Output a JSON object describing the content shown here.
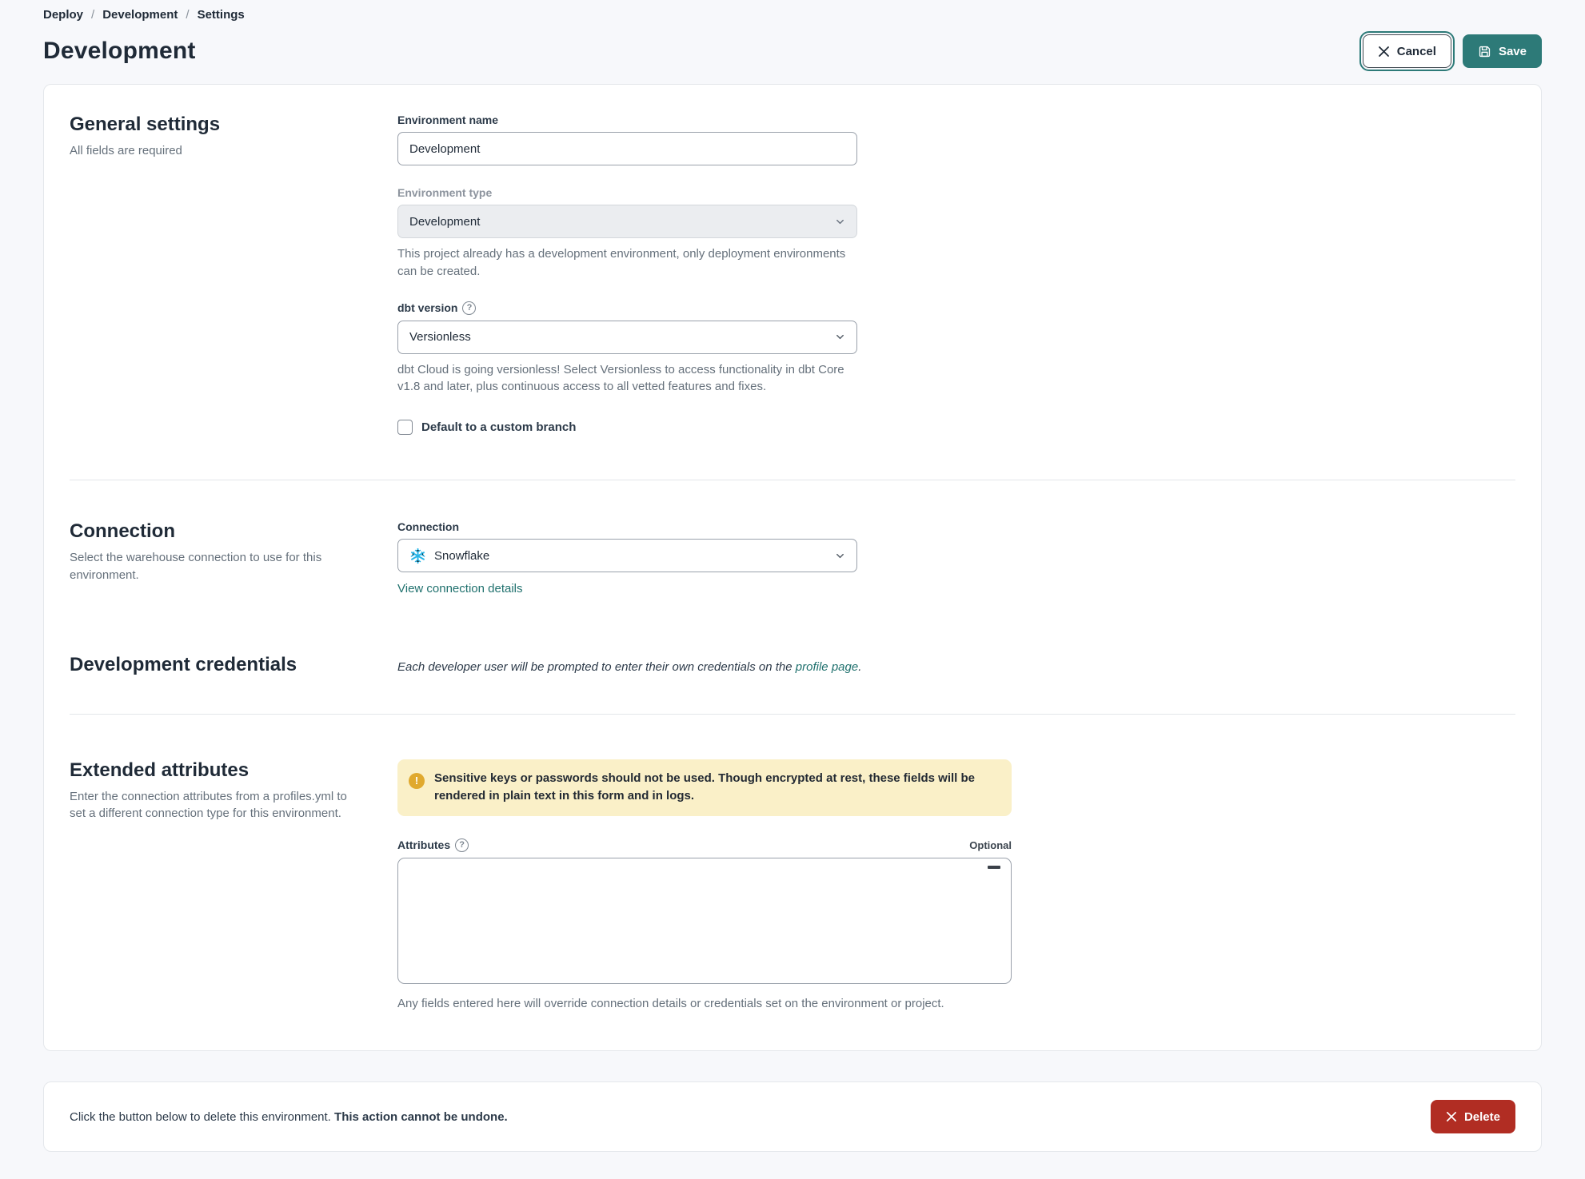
{
  "breadcrumb": {
    "items": [
      "Deploy",
      "Development",
      "Settings"
    ],
    "separator": "/"
  },
  "header": {
    "title": "Development",
    "cancel_label": "Cancel",
    "save_label": "Save"
  },
  "general": {
    "heading": "General settings",
    "subheading": "All fields are required",
    "env_name": {
      "label": "Environment name",
      "value": "Development"
    },
    "env_type": {
      "label": "Environment type",
      "value": "Development",
      "help": "This project already has a development environment, only deployment environments can be created."
    },
    "dbt_version": {
      "label": "dbt version",
      "value": "Versionless",
      "help": "dbt Cloud is going versionless! Select Versionless to access functionality in dbt Core v1.8 and later, plus continuous access to all vetted features and fixes."
    },
    "custom_branch": {
      "label": "Default to a custom branch",
      "checked": false
    }
  },
  "connection": {
    "heading": "Connection",
    "subheading": "Select the warehouse connection to use for this environment.",
    "field_label": "Connection",
    "value": "Snowflake",
    "link_label": "View connection details"
  },
  "credentials": {
    "heading": "Development credentials",
    "text_before": "Each developer user will be prompted to enter their own credentials on the ",
    "link_label": "profile page",
    "text_after": "."
  },
  "extended": {
    "heading": "Extended attributes",
    "subheading": "Enter the connection attributes from a profiles.yml to set a different connection type for this environment.",
    "warning": "Sensitive keys or passwords should not be used. Though encrypted at rest, these fields will be rendered in plain text in this form and in logs.",
    "attributes_label": "Attributes",
    "optional_label": "Optional",
    "textarea_value": "",
    "help": "Any fields entered here will override connection details or credentials set on the environment or project."
  },
  "danger": {
    "text_before": "Click the button below to delete this environment. ",
    "text_bold": "This action cannot be undone.",
    "delete_label": "Delete"
  },
  "icons": {
    "help_glyph": "?",
    "warning_glyph": "!"
  },
  "colors": {
    "accent_teal": "#2d7a78",
    "link_teal": "#20716e",
    "danger_red": "#b12d23",
    "warning_bg": "#faf0c8",
    "warning_icon": "#e0a92e",
    "snowflake_blue": "#29b5e8"
  }
}
